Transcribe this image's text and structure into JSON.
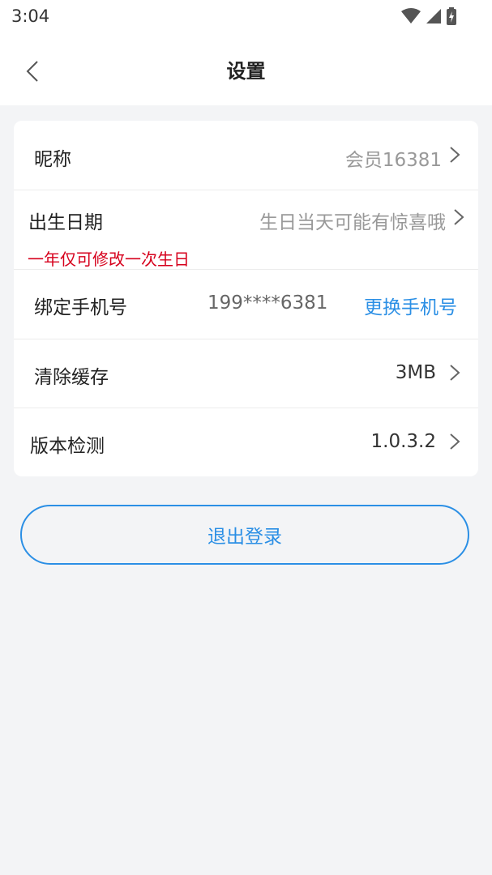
{
  "status_bar": {
    "time": "3:04"
  },
  "header": {
    "title": "设置"
  },
  "settings": {
    "nickname": {
      "label": "昵称",
      "value": "会员16381"
    },
    "birthday": {
      "label": "出生日期",
      "value": "生日当天可能有惊喜哦",
      "hint": "一年仅可修改一次生日"
    },
    "phone": {
      "label": "绑定手机号",
      "value": "199****6381",
      "action": "更换手机号"
    },
    "cache": {
      "label": "清除缓存",
      "value": "3MB"
    },
    "version": {
      "label": "版本检测",
      "value": "1.0.3.2"
    }
  },
  "logout": {
    "label": "退出登录"
  },
  "colors": {
    "accent": "#2b8fe5",
    "warning": "#d6001c",
    "background": "#f3f4f6"
  }
}
